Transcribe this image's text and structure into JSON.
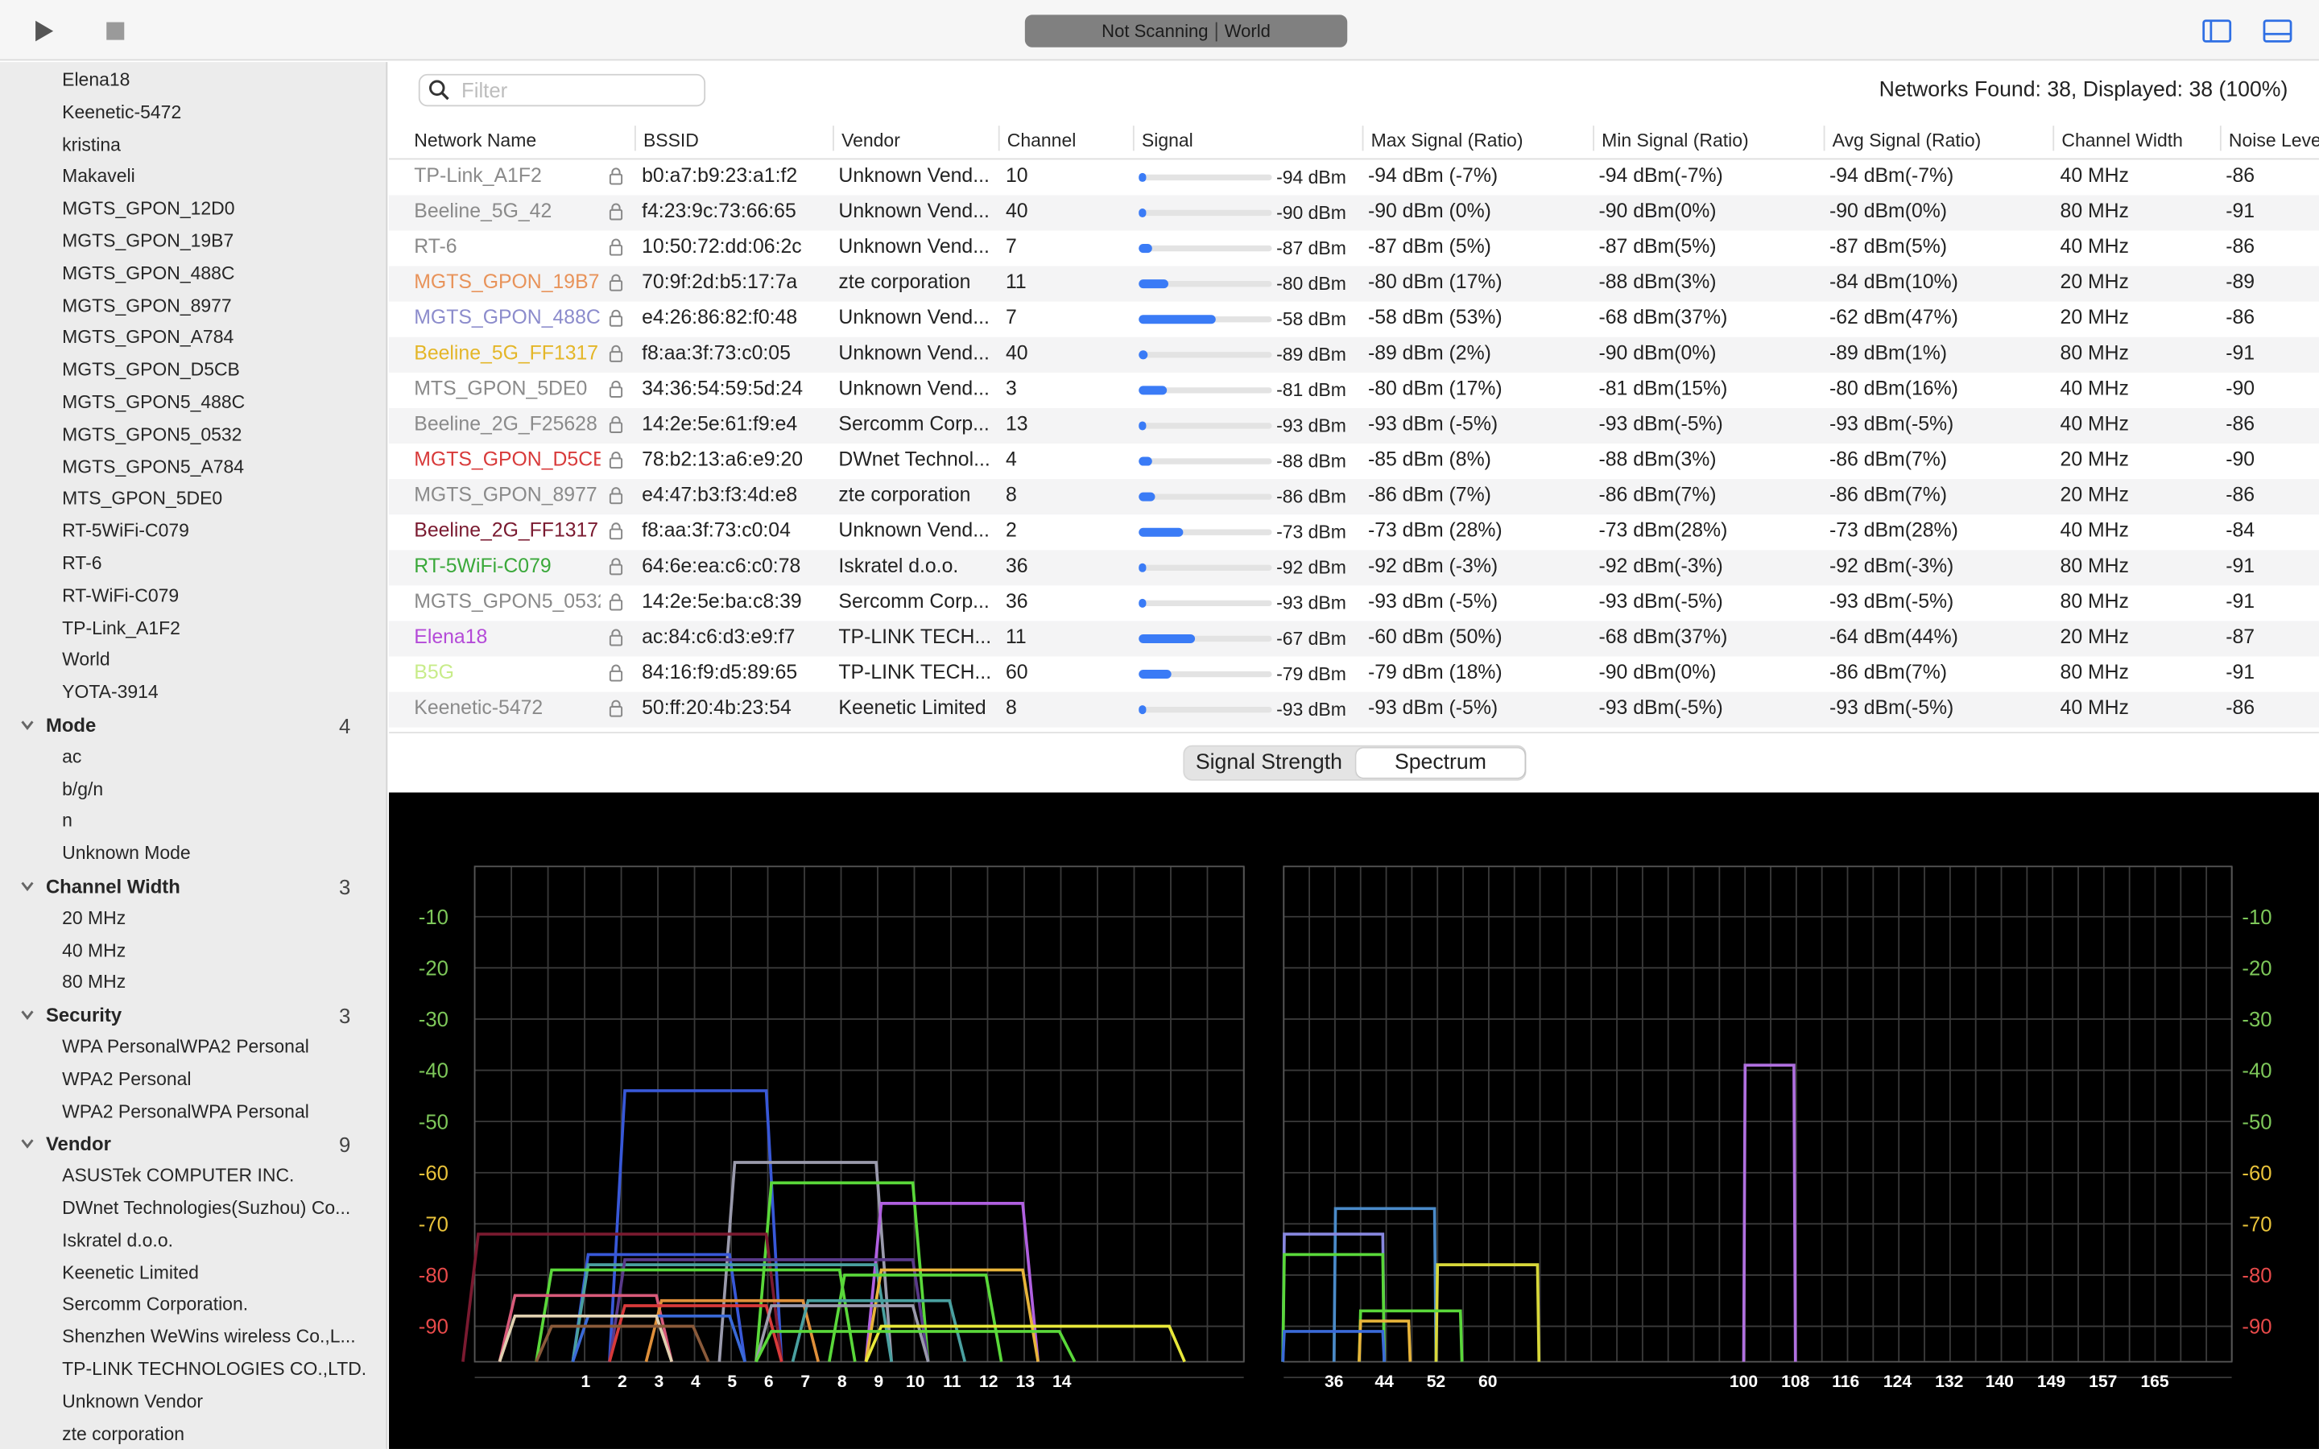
{
  "toolbar": {
    "status_left": "Not Scanning",
    "status_right": "World"
  },
  "sidebar": {
    "ssid_items": [
      "Elena18",
      "Keenetic-5472",
      "kristina",
      "Makaveli",
      "MGTS_GPON_12D0",
      "MGTS_GPON_19B7",
      "MGTS_GPON_488C",
      "MGTS_GPON_8977",
      "MGTS_GPON_A784",
      "MGTS_GPON_D5CB",
      "MGTS_GPON5_488C",
      "MGTS_GPON5_0532",
      "MGTS_GPON5_A784",
      "MTS_GPON_5DE0",
      "RT-5WiFi-C079",
      "RT-6",
      "RT-WiFi-C079",
      "TP-Link_A1F2",
      "World",
      "YOTA-3914"
    ],
    "mode": {
      "label": "Mode",
      "count": "4",
      "items": [
        "ac",
        "b/g/n",
        "n",
        "Unknown Mode"
      ]
    },
    "channel_width": {
      "label": "Channel Width",
      "count": "3",
      "items": [
        "20 MHz",
        "40 MHz",
        "80 MHz"
      ]
    },
    "security": {
      "label": "Security",
      "count": "3",
      "items": [
        "WPA PersonalWPA2 Personal",
        "WPA2 Personal",
        "WPA2 PersonalWPA Personal"
      ]
    },
    "vendor": {
      "label": "Vendor",
      "count": "9",
      "items": [
        "ASUSTek COMPUTER INC.",
        "DWnet Technologies(Suzhou) Co...",
        "Iskratel d.o.o.",
        "Keenetic Limited",
        "Sercomm Corporation.",
        "Shenzhen WeWins wireless Co.,L...",
        "TP-LINK TECHNOLOGIES CO.,LTD.",
        "Unknown Vendor",
        "zte corporation"
      ]
    }
  },
  "filter": {
    "placeholder": "Filter"
  },
  "networks_found": "Networks Found: 38, Displayed: 38 (100%)",
  "columns": [
    "Network Name",
    "BSSID",
    "Vendor",
    "Channel",
    "Signal",
    "Max Signal (Ratio)",
    "Min Signal (Ratio)",
    "Avg Signal (Ratio)",
    "Channel Width",
    "Noise Leve"
  ],
  "rows": [
    {
      "name": "TP-Link_A1F2",
      "color": "#8a8a8a",
      "bssid": "b0:a7:b9:23:a1:f2",
      "vendor": "Unknown Vend...",
      "channel": "10",
      "signal": "-94 dBm",
      "pct": 0.05,
      "max": "-94 dBm (-7%)",
      "min": "-94 dBm(-7%)",
      "avg": "-94 dBm(-7%)",
      "width": "40 MHz",
      "noise": "-86"
    },
    {
      "name": "Beeline_5G_42",
      "color": "#8a8a8a",
      "bssid": "f4:23:9c:73:66:65",
      "vendor": "Unknown Vend...",
      "channel": "40",
      "signal": "-90 dBm",
      "pct": 0.06,
      "max": "-90 dBm (0%)",
      "min": "-90 dBm(0%)",
      "avg": "-90 dBm(0%)",
      "width": "80 MHz",
      "noise": "-91"
    },
    {
      "name": "RT-6",
      "color": "#8a8a8a",
      "bssid": "10:50:72:dd:06:2c",
      "vendor": "Unknown Vend...",
      "channel": "7",
      "signal": "-87 dBm",
      "pct": 0.1,
      "max": "-87 dBm (5%)",
      "min": "-87 dBm(5%)",
      "avg": "-87 dBm(5%)",
      "width": "40 MHz",
      "noise": "-86"
    },
    {
      "name": "MGTS_GPON_19B7",
      "color": "#e8935a",
      "bssid": "70:9f:2d:b5:17:7a",
      "vendor": "zte corporation",
      "channel": "11",
      "signal": "-80 dBm",
      "pct": 0.22,
      "max": "-80 dBm (17%)",
      "min": "-88 dBm(3%)",
      "avg": "-84 dBm(10%)",
      "width": "20 MHz",
      "noise": "-89"
    },
    {
      "name": "MGTS_GPON_488C",
      "color": "#8c8ccc",
      "bssid": "e4:26:86:82:f0:48",
      "vendor": "Unknown Vend...",
      "channel": "7",
      "signal": "-58 dBm",
      "pct": 0.58,
      "max": "-58 dBm (53%)",
      "min": "-68 dBm(37%)",
      "avg": "-62 dBm(47%)",
      "width": "20 MHz",
      "noise": "-86"
    },
    {
      "name": "Beeline_5G_FF1317",
      "color": "#e4b628",
      "bssid": "f8:aa:3f:73:c0:05",
      "vendor": "Unknown Vend...",
      "channel": "40",
      "signal": "-89 dBm",
      "pct": 0.07,
      "max": "-89 dBm (2%)",
      "min": "-90 dBm(0%)",
      "avg": "-89 dBm(1%)",
      "width": "80 MHz",
      "noise": "-91"
    },
    {
      "name": "MTS_GPON_5DE0",
      "color": "#8a8a8a",
      "bssid": "34:36:54:59:5d:24",
      "vendor": "Unknown Vend...",
      "channel": "3",
      "signal": "-81 dBm",
      "pct": 0.21,
      "max": "-80 dBm (17%)",
      "min": "-81 dBm(15%)",
      "avg": "-80 dBm(16%)",
      "width": "40 MHz",
      "noise": "-90"
    },
    {
      "name": "Beeline_2G_F25628",
      "color": "#8a8a8a",
      "bssid": "14:2e:5e:61:f9:e4",
      "vendor": "Sercomm Corp...",
      "channel": "13",
      "signal": "-93 dBm",
      "pct": 0.05,
      "max": "-93 dBm (-5%)",
      "min": "-93 dBm(-5%)",
      "avg": "-93 dBm(-5%)",
      "width": "40 MHz",
      "noise": "-86"
    },
    {
      "name": "MGTS_GPON_D5CB",
      "color": "#d83a3a",
      "bssid": "78:b2:13:a6:e9:20",
      "vendor": "DWnet Technol...",
      "channel": "4",
      "signal": "-88 dBm",
      "pct": 0.1,
      "max": "-85 dBm (8%)",
      "min": "-88 dBm(3%)",
      "avg": "-86 dBm(7%)",
      "width": "20 MHz",
      "noise": "-90"
    },
    {
      "name": "MGTS_GPON_8977",
      "color": "#8a8a8a",
      "bssid": "e4:47:b3:f3:4d:e8",
      "vendor": "zte corporation",
      "channel": "8",
      "signal": "-86 dBm",
      "pct": 0.12,
      "max": "-86 dBm (7%)",
      "min": "-86 dBm(7%)",
      "avg": "-86 dBm(7%)",
      "width": "20 MHz",
      "noise": "-86"
    },
    {
      "name": "Beeline_2G_FF1317",
      "color": "#7a1a30",
      "bssid": "f8:aa:3f:73:c0:04",
      "vendor": "Unknown Vend...",
      "channel": "2",
      "signal": "-73 dBm",
      "pct": 0.33,
      "max": "-73 dBm (28%)",
      "min": "-73 dBm(28%)",
      "avg": "-73 dBm(28%)",
      "width": "40 MHz",
      "noise": "-84"
    },
    {
      "name": "RT-5WiFi-C079",
      "color": "#3aa83a",
      "bssid": "64:6e:ea:c6:c0:78",
      "vendor": "Iskratel d.o.o.",
      "channel": "36",
      "signal": "-92 dBm",
      "pct": 0.06,
      "max": "-92 dBm (-3%)",
      "min": "-92 dBm(-3%)",
      "avg": "-92 dBm(-3%)",
      "width": "80 MHz",
      "noise": "-91"
    },
    {
      "name": "MGTS_GPON5_0532",
      "color": "#8a8a8a",
      "bssid": "14:2e:5e:ba:c8:39",
      "vendor": "Sercomm Corp...",
      "channel": "36",
      "signal": "-93 dBm",
      "pct": 0.05,
      "max": "-93 dBm (-5%)",
      "min": "-93 dBm(-5%)",
      "avg": "-93 dBm(-5%)",
      "width": "80 MHz",
      "noise": "-91"
    },
    {
      "name": "Elena18",
      "color": "#b44ad8",
      "bssid": "ac:84:c6:d3:e9:f7",
      "vendor": "TP-LINK TECH...",
      "channel": "11",
      "signal": "-67 dBm",
      "pct": 0.42,
      "max": "-60 dBm (50%)",
      "min": "-68 dBm(37%)",
      "avg": "-64 dBm(44%)",
      "width": "20 MHz",
      "noise": "-87"
    },
    {
      "name": "B5G",
      "color": "#c8ec8a",
      "bssid": "84:16:f9:d5:89:65",
      "vendor": "TP-LINK TECH...",
      "channel": "60",
      "signal": "-79 dBm",
      "pct": 0.24,
      "max": "-79 dBm (18%)",
      "min": "-90 dBm(0%)",
      "avg": "-86 dBm(7%)",
      "width": "80 MHz",
      "noise": "-91"
    },
    {
      "name": "Keenetic-5472",
      "color": "#8a8a8a",
      "bssid": "50:ff:20:4b:23:54",
      "vendor": "Keenetic Limited",
      "channel": "8",
      "signal": "-93 dBm",
      "pct": 0.05,
      "max": "-93 dBm (-5%)",
      "min": "-93 dBm(-5%)",
      "avg": "-93 dBm(-5%)",
      "width": "40 MHz",
      "noise": "-86"
    }
  ],
  "tabs": {
    "signal_strength": "Signal Strength",
    "spectrum": "Spectrum",
    "selected": "Spectrum"
  },
  "chart_data": [
    {
      "type": "area",
      "ylim": [
        -100,
        0
      ],
      "y_ticks": [
        -10,
        -20,
        -30,
        -40,
        -50,
        -60,
        -70,
        -80,
        -90
      ],
      "x_ticks": [
        "1",
        "2",
        "3",
        "4",
        "5",
        "6",
        "7",
        "8",
        "9",
        "10",
        "11",
        "12",
        "13",
        "14"
      ],
      "series": [
        {
          "color": "#3858d8",
          "channel": 4,
          "width_ch": 4,
          "level": -44
        },
        {
          "color": "#9a9aac",
          "channel": 7,
          "width_ch": 4,
          "level": -58
        },
        {
          "color": "#5ad83a",
          "channel": 8,
          "width_ch": 4,
          "level": -62
        },
        {
          "color": "#b060e0",
          "channel": 11,
          "width_ch": 4,
          "level": -66
        },
        {
          "color": "#7a1a30",
          "channel": 2,
          "width_ch": 8,
          "level": -72
        },
        {
          "color": "#3858d8",
          "channel": 3,
          "width_ch": 4,
          "level": -76
        },
        {
          "color": "#4aa0a0",
          "channel": 5,
          "width_ch": 8,
          "level": -78
        },
        {
          "color": "#5a3a8a",
          "channel": 6,
          "width_ch": 8,
          "level": -77
        },
        {
          "color": "#5ad83a",
          "channel": 4,
          "width_ch": 8,
          "level": -79
        },
        {
          "color": "#e8b43a",
          "channel": 11,
          "width_ch": 4,
          "level": -79
        },
        {
          "color": "#5ad83a",
          "channel": 10,
          "width_ch": 4,
          "level": -80
        },
        {
          "color": "#d85a7a",
          "channel": 1,
          "width_ch": 4,
          "level": -84
        },
        {
          "color": "#e0903a",
          "channel": 5,
          "width_ch": 4,
          "level": -85
        },
        {
          "color": "#4aa0a0",
          "channel": 9,
          "width_ch": 4,
          "level": -85
        },
        {
          "color": "#d83a3a",
          "channel": 4,
          "width_ch": 4,
          "level": -86
        },
        {
          "color": "#9a9aac",
          "channel": 8,
          "width_ch": 4,
          "level": -86
        },
        {
          "color": "#3a6ad8",
          "channel": 3,
          "width_ch": 4,
          "level": -88
        },
        {
          "color": "#e0d0b0",
          "channel": 1,
          "width_ch": 4,
          "level": -88
        },
        {
          "color": "#e8e83a",
          "channel": 13,
          "width_ch": 8,
          "level": -90
        },
        {
          "color": "#5ad83a",
          "channel": 10,
          "width_ch": 8,
          "level": -91
        },
        {
          "color": "#8a5a3a",
          "channel": 2,
          "width_ch": 4,
          "level": -90
        }
      ]
    },
    {
      "type": "area",
      "ylim": [
        -100,
        0
      ],
      "y_ticks": [
        -10,
        -20,
        -30,
        -40,
        -50,
        -60,
        -70,
        -80,
        -90
      ],
      "x_ticks": [
        "36",
        "44",
        "52",
        "60",
        "100",
        "108",
        "116",
        "124",
        "132",
        "140",
        "149",
        "157",
        "165"
      ],
      "series": [
        {
          "color": "#b070e0",
          "channel": 104,
          "width_ch": 8,
          "level": -39
        },
        {
          "color": "#4a8ac8",
          "channel": 44,
          "width_ch": 16,
          "level": -67
        },
        {
          "color": "#8888e0",
          "channel": 36,
          "width_ch": 16,
          "level": -72
        },
        {
          "color": "#d8d83a",
          "channel": 60,
          "width_ch": 16,
          "level": -78
        },
        {
          "color": "#5ad83a",
          "channel": 36,
          "width_ch": 16,
          "level": -76
        },
        {
          "color": "#5ad83a",
          "channel": 48,
          "width_ch": 16,
          "level": -87
        },
        {
          "color": "#e8b43a",
          "channel": 44,
          "width_ch": 8,
          "level": -89
        },
        {
          "color": "#3a6ad8",
          "channel": 36,
          "width_ch": 16,
          "level": -91
        }
      ]
    }
  ]
}
